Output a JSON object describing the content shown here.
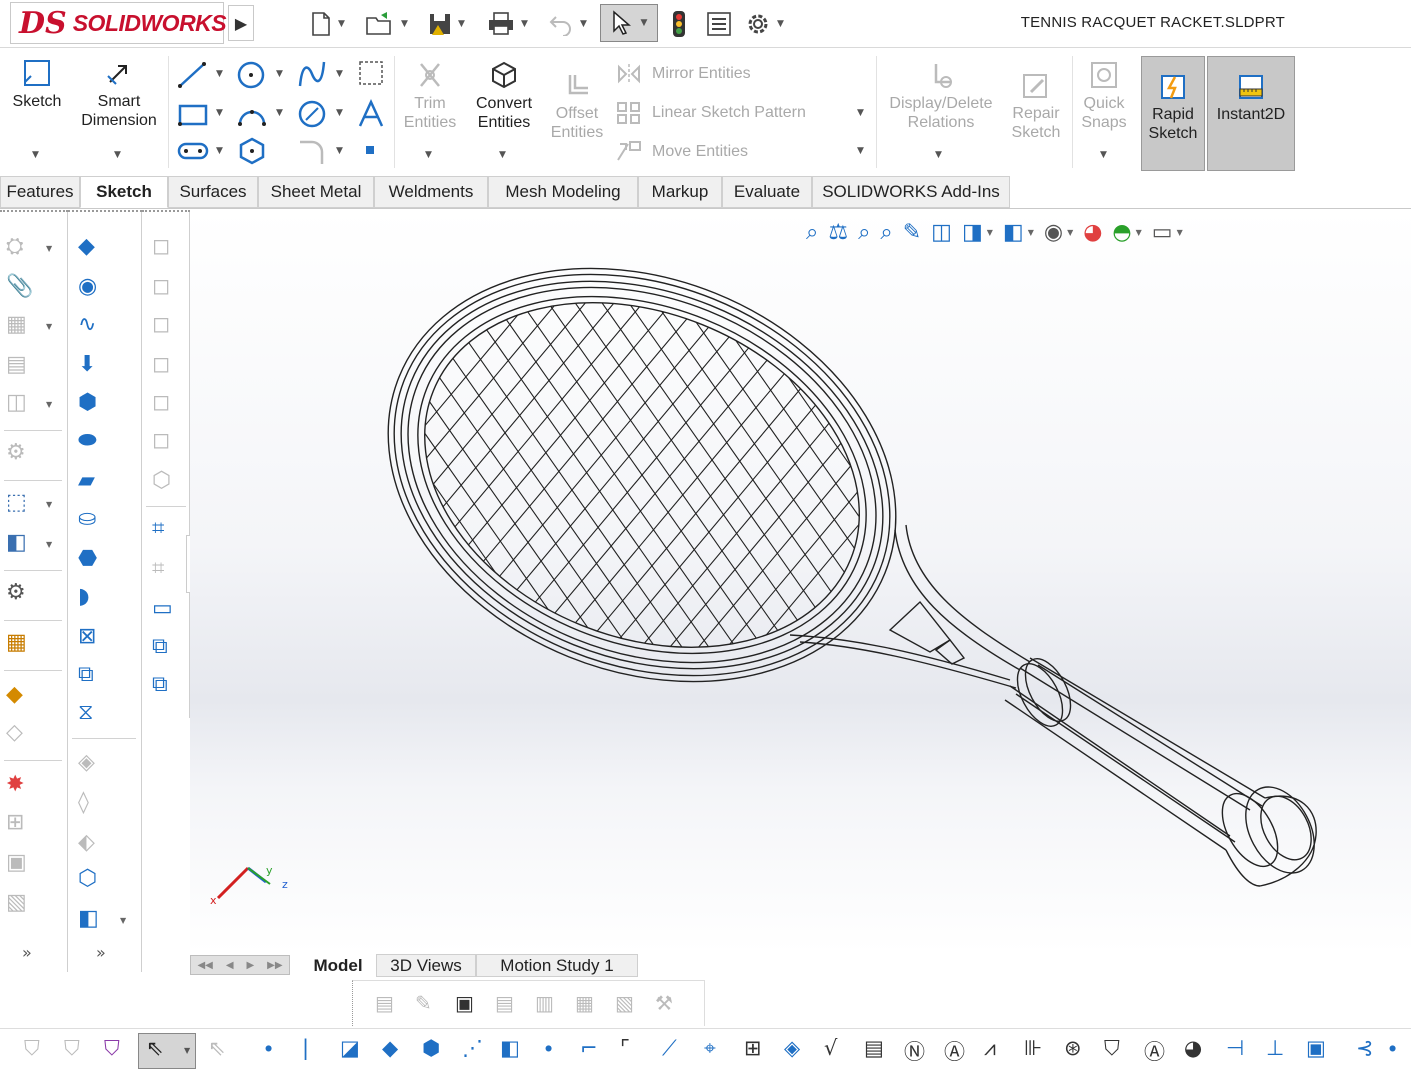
{
  "window": {
    "logo_mark": "DS",
    "logo_wordmark": "SOLIDWORKS",
    "document_title": "TENNIS RACQUET RACKET.SLDPRT"
  },
  "quick_access": [
    {
      "name": "new-document",
      "icon": "new-document-icon"
    },
    {
      "name": "open",
      "icon": "open-folder-icon"
    },
    {
      "name": "save",
      "icon": "save-icon"
    },
    {
      "name": "print",
      "icon": "print-icon"
    },
    {
      "name": "undo",
      "icon": "undo-icon"
    },
    {
      "name": "select",
      "icon": "cursor-icon"
    },
    {
      "name": "rebuild",
      "icon": "traffic-light-icon"
    },
    {
      "name": "file-properties",
      "icon": "file-properties-icon"
    },
    {
      "name": "options",
      "icon": "gear-icon"
    }
  ],
  "ribbon": {
    "sketch_label": "Sketch",
    "smart_dimension_label": "Smart Dimension",
    "trim_entities_label": "Trim Entities",
    "convert_entities_label": "Convert Entities",
    "offset_entities_label": "Offset Entities",
    "mirror_entities_label": "Mirror Entities",
    "linear_sketch_pattern_label": "Linear Sketch Pattern",
    "move_entities_label": "Move Entities",
    "display_delete_relations_label": "Display/Delete Relations",
    "repair_sketch_label": "Repair Sketch",
    "quick_snaps_label": "Quick Snaps",
    "rapid_sketch_label": "Rapid Sketch",
    "instant2d_label": "Instant2D"
  },
  "tabs": [
    "Features",
    "Sketch",
    "Surfaces",
    "Sheet Metal",
    "Weldments",
    "Mesh Modeling",
    "Markup",
    "Evaluate",
    "SOLIDWORKS Add-Ins"
  ],
  "active_tab": "Sketch",
  "triad": {
    "x_label": "x",
    "y_label": "y",
    "z_label": "z"
  },
  "bottom_tabs": [
    "Model",
    "3D Views",
    "Motion Study 1"
  ],
  "active_bottom_tab": "Model",
  "colors": {
    "brand": "#c8102e",
    "sketch_blue": "#1f6fc4",
    "disabled_gray": "#a9a9a9",
    "active_button_bg": "#c8c8c8"
  }
}
